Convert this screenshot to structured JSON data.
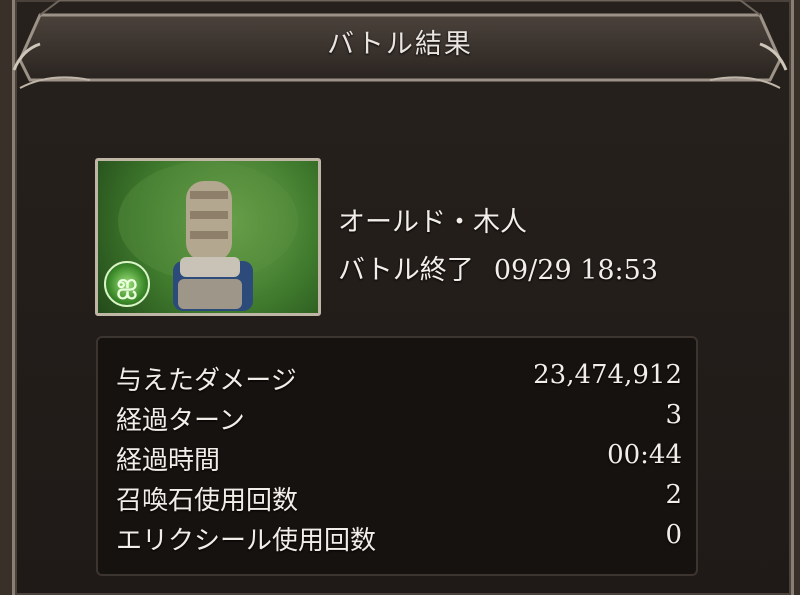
{
  "header": {
    "title": "バトル結果"
  },
  "enemy": {
    "name": "オールド・木人",
    "status_label": "バトル終了",
    "timestamp": "09/29 18:53",
    "element_icon": "wind-element-icon"
  },
  "stats": [
    {
      "label": "与えたダメージ",
      "value": "23,474,912"
    },
    {
      "label": "経過ターン",
      "value": "3"
    },
    {
      "label": "経過時間",
      "value": "00:44"
    },
    {
      "label": "召喚石使用回数",
      "value": "2"
    },
    {
      "label": "エリクシール使用回数",
      "value": "0"
    }
  ]
}
